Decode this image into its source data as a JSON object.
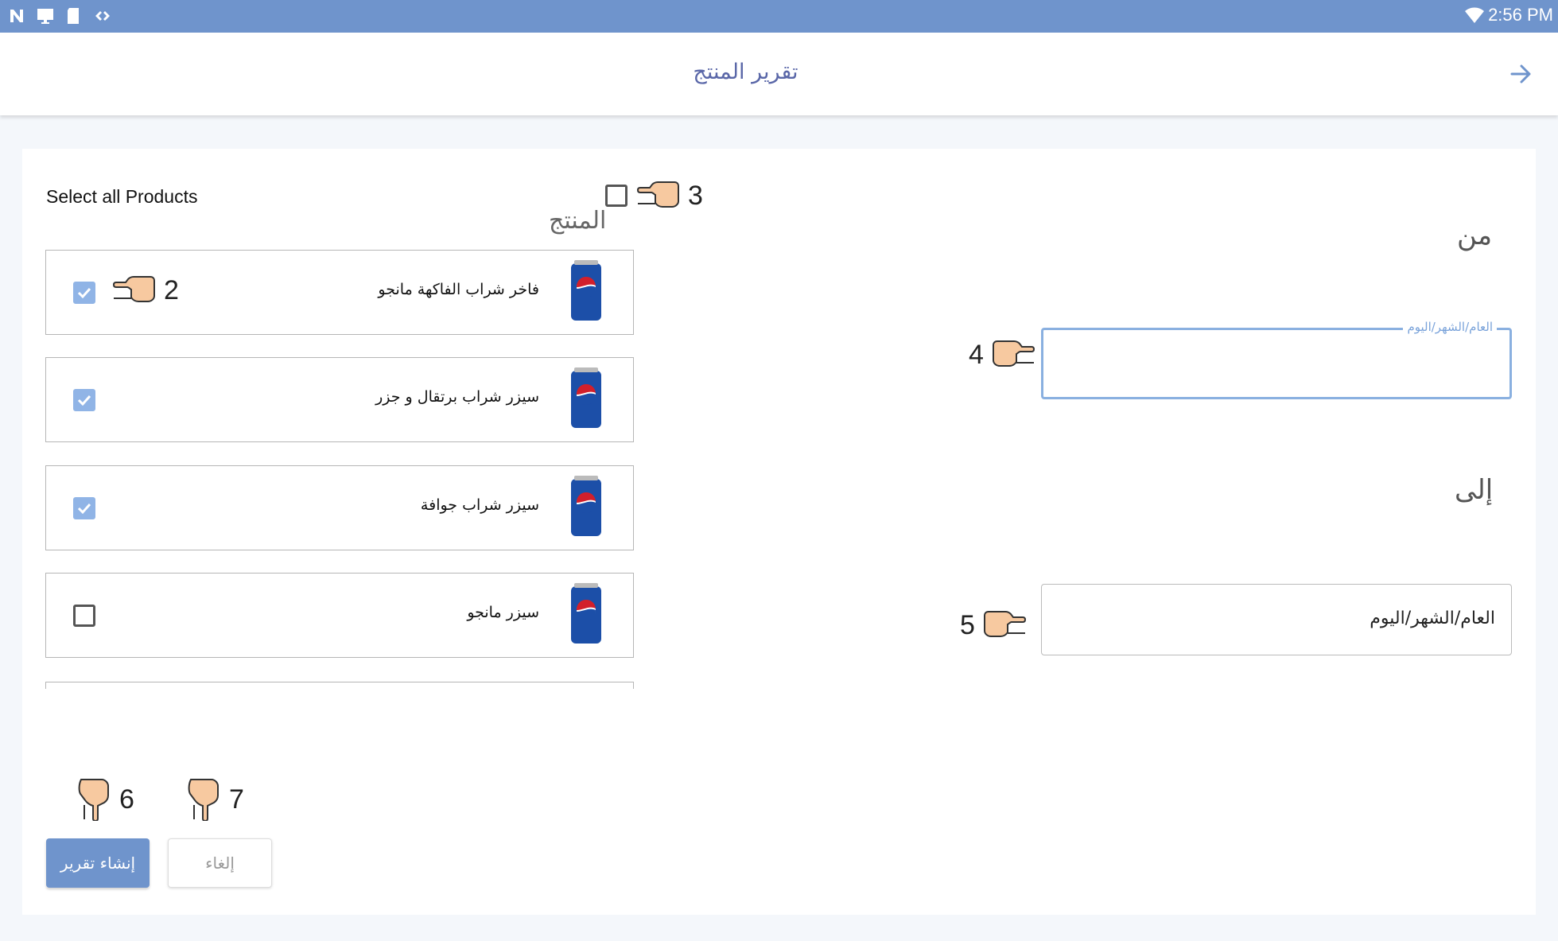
{
  "status_bar": {
    "time": "2:56 PM",
    "left_icons": [
      "n-logo-icon",
      "monitor-icon",
      "sd-card-icon",
      "code-icon"
    ],
    "wifi_icon": "wifi-icon"
  },
  "app_bar": {
    "title": "تقرير المنتج",
    "back_icon": "arrow-right-icon"
  },
  "products": {
    "select_all_label": "Select all Products",
    "select_all_checked": false,
    "column_label": "المنتج",
    "items": [
      {
        "name": "فاخر شراب الفاكهة مانجو",
        "checked": true,
        "image": "pepsi-can-icon"
      },
      {
        "name": "سيزر شراب برتقال و جزر",
        "checked": true,
        "image": "pepsi-can-icon"
      },
      {
        "name": "سيزر شراب جوافة",
        "checked": true,
        "image": "pepsi-can-icon"
      },
      {
        "name": "سيزر مانجو",
        "checked": false,
        "image": "pepsi-can-icon"
      }
    ]
  },
  "date_range": {
    "from_label": "من",
    "from_floating_label": "العام/الشهر/اليوم",
    "from_value": "",
    "to_label": "إلى",
    "to_placeholder": "العام/الشهر/اليوم"
  },
  "annotations": {
    "a2": "2",
    "a3": "3",
    "a4": "4",
    "a5": "5",
    "a6": "6",
    "a7": "7"
  },
  "actions": {
    "create_report": "إنشاء تقرير",
    "cancel": "إلغاء"
  },
  "colors": {
    "status_bar": "#6f94cc",
    "title": "#5a67a8",
    "accent": "#90b4e6",
    "focus_border": "#8ab0e0"
  }
}
